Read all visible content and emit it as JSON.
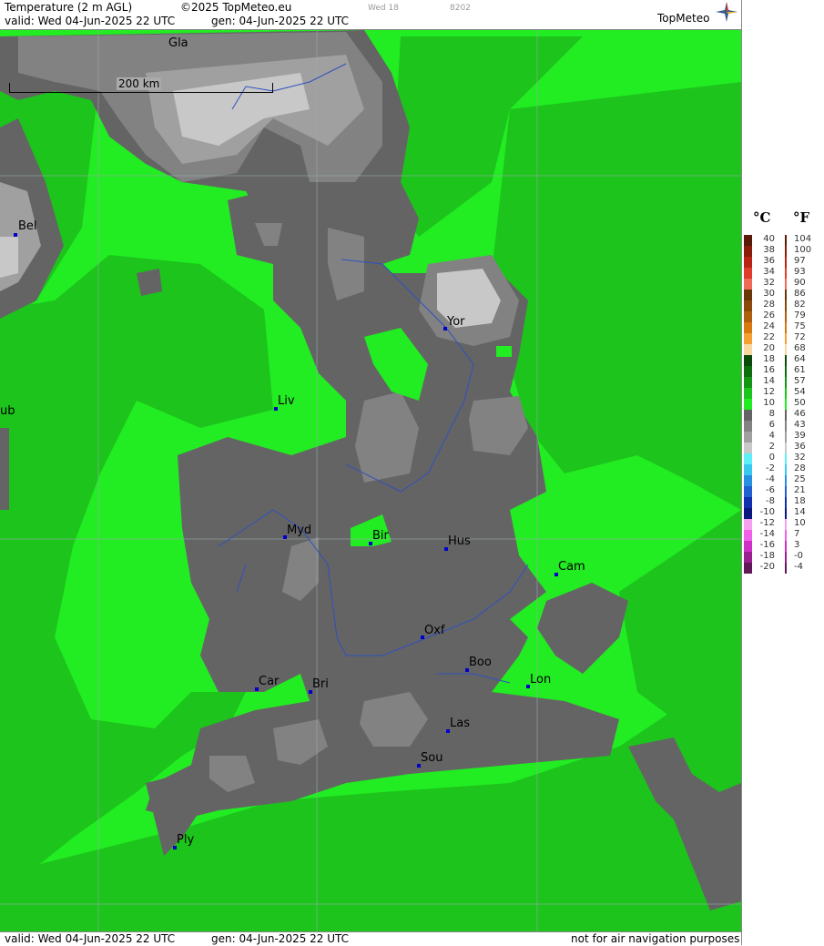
{
  "header": {
    "title": "Temperature (2 m AGL)",
    "copyright": "©2025 TopMeteo.eu",
    "day_code": "Wed 18",
    "run_code": "8202",
    "valid": "valid:  Wed  04-Jun-2025  22 UTC",
    "generated": "gen: 04-Jun-2025 22 UTC",
    "logo": "TopMeteo"
  },
  "footer": {
    "valid": "valid:  Wed  04-Jun-2025  22 UTC",
    "generated": "gen: 04-Jun-2025 22 UTC",
    "disclaimer": "not for air navigation purposes"
  },
  "scale_bar": {
    "label": "200 km"
  },
  "legend": {
    "celsius_unit": "°C",
    "fahrenheit_unit": "°F",
    "rows": [
      {
        "c": "40",
        "f": "104",
        "color": "#5a1a08"
      },
      {
        "c": "38",
        "f": "100",
        "color": "#8a1c0c"
      },
      {
        "c": "36",
        "f": "97",
        "color": "#b82414"
      },
      {
        "c": "34",
        "f": "93",
        "color": "#e03c2c"
      },
      {
        "c": "32",
        "f": "90",
        "color": "#f06a5a"
      },
      {
        "c": "30",
        "f": "86",
        "color": "#6a3808"
      },
      {
        "c": "28",
        "f": "82",
        "color": "#8c4a0a"
      },
      {
        "c": "26",
        "f": "79",
        "color": "#b0600c"
      },
      {
        "c": "24",
        "f": "75",
        "color": "#d87810"
      },
      {
        "c": "22",
        "f": "72",
        "color": "#f5a030"
      },
      {
        "c": "20",
        "f": "68",
        "color": "#f8d8a0"
      },
      {
        "c": "18",
        "f": "64",
        "color": "#0a4a0a"
      },
      {
        "c": "16",
        "f": "61",
        "color": "#0e6e0e"
      },
      {
        "c": "14",
        "f": "57",
        "color": "#149614"
      },
      {
        "c": "12",
        "f": "54",
        "color": "#1cc41c"
      },
      {
        "c": "10",
        "f": "50",
        "color": "#22ec22"
      },
      {
        "c": "8",
        "f": "46",
        "color": "#646464"
      },
      {
        "c": "6",
        "f": "43",
        "color": "#828282"
      },
      {
        "c": "4",
        "f": "39",
        "color": "#a0a0a0"
      },
      {
        "c": "2",
        "f": "36",
        "color": "#c8c8c8"
      },
      {
        "c": "0",
        "f": "32",
        "color": "#5ef0f8"
      },
      {
        "c": "-2",
        "f": "28",
        "color": "#38c8f0"
      },
      {
        "c": "-4",
        "f": "25",
        "color": "#2890e0"
      },
      {
        "c": "-6",
        "f": "21",
        "color": "#2060d0"
      },
      {
        "c": "-8",
        "f": "18",
        "color": "#1030b0"
      },
      {
        "c": "-10",
        "f": "14",
        "color": "#0a1880"
      },
      {
        "c": "-12",
        "f": "10",
        "color": "#f8a0f0"
      },
      {
        "c": "-14",
        "f": "7",
        "color": "#f060e8"
      },
      {
        "c": "-16",
        "f": "3",
        "color": "#d030c8"
      },
      {
        "c": "-18",
        "f": "-0",
        "color": "#9a2090"
      },
      {
        "c": "-20",
        "f": "-4",
        "color": "#601858"
      }
    ]
  },
  "cities": [
    {
      "name": "Gla",
      "dot": false
    },
    {
      "name": "Bel",
      "dot": true
    },
    {
      "name": "Yor",
      "dot": true
    },
    {
      "name": "Liv",
      "dot": true
    },
    {
      "name": "ub",
      "dot": false
    },
    {
      "name": "Myd",
      "dot": true
    },
    {
      "name": "Bir",
      "dot": true
    },
    {
      "name": "Hus",
      "dot": true
    },
    {
      "name": "Cam",
      "dot": true
    },
    {
      "name": "Oxf",
      "dot": true
    },
    {
      "name": "Boo",
      "dot": true
    },
    {
      "name": "Lon",
      "dot": true
    },
    {
      "name": "Car",
      "dot": true
    },
    {
      "name": "Bri",
      "dot": true
    },
    {
      "name": "Las",
      "dot": true
    },
    {
      "name": "Sou",
      "dot": true
    },
    {
      "name": "Ply",
      "dot": true
    }
  ]
}
